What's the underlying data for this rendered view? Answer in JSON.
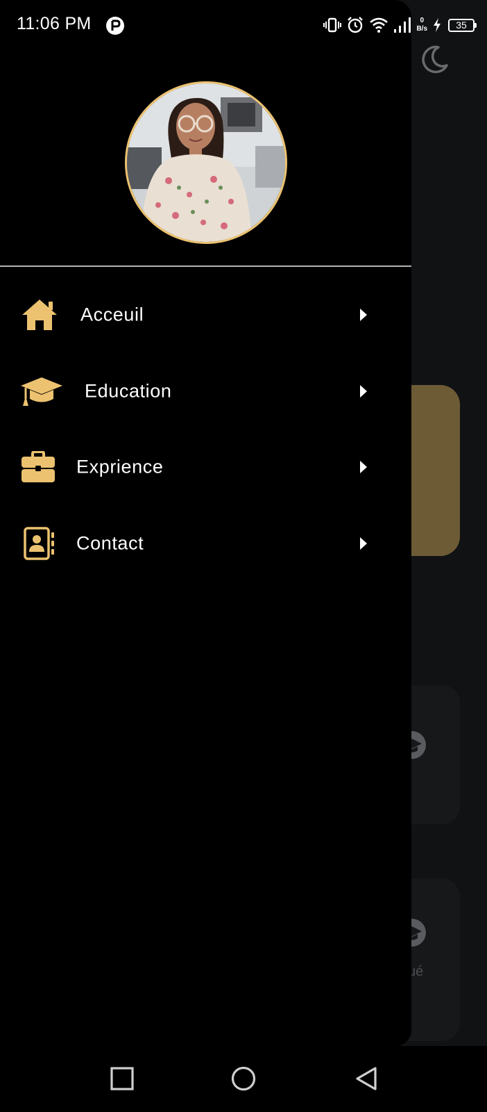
{
  "status_bar": {
    "time": "11:06 PM",
    "net_speed_value": "0",
    "net_speed_unit": "B/s",
    "battery_level": "35"
  },
  "background_app": {
    "partial_card_text": "ué"
  },
  "drawer": {
    "menu_items": [
      {
        "label": "Acceuil",
        "icon": "home-icon"
      },
      {
        "label": "Education",
        "icon": "graduation-cap-icon"
      },
      {
        "label": "Exprience",
        "icon": "briefcase-icon"
      },
      {
        "label": "Contact",
        "icon": "address-book-icon"
      }
    ]
  },
  "colors": {
    "accent": "#ECC270",
    "drawer_background": "#000000",
    "app_background": "#111214",
    "gold_card": "#6D5B36",
    "text": "#FFFFFF"
  },
  "navigation_bar": {
    "buttons": [
      "recents-icon",
      "home-circle-icon",
      "back-icon"
    ]
  }
}
